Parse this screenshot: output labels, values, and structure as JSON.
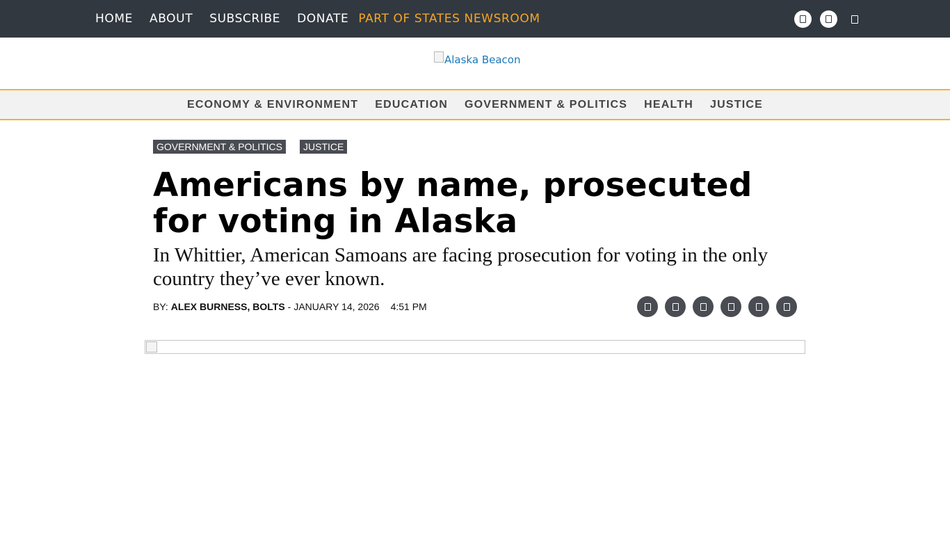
{
  "topnav": {
    "links": [
      "HOME",
      "ABOUT",
      "SUBSCRIBE",
      "DONATE"
    ],
    "states_link": "PART OF STATES NEWSROOM",
    "social_icons": [
      "facebook-icon",
      "twitter-icon"
    ],
    "search_icon": "search-icon"
  },
  "logo": {
    "alt": "Alaska Beacon"
  },
  "sections": [
    "ECONOMY & ENVIRONMENT",
    "EDUCATION",
    "GOVERNMENT & POLITICS",
    "HEALTH",
    "JUSTICE"
  ],
  "article": {
    "tags": [
      "GOVERNMENT & POLITICS",
      "JUSTICE"
    ],
    "headline": "Americans by name, prosecuted for voting in Alaska",
    "subhead": "In Whittier, American Samoans are facing prosecution for voting in the only country they’ve ever known.",
    "byline_prefix": "BY:",
    "author": "ALEX BURNESS, BOLTS",
    "separator": "-",
    "date": "JANUARY 14, 2026",
    "time": "4:51 PM",
    "share_icons": [
      "facebook-icon",
      "twitter-icon",
      "bluesky-icon",
      "email-icon",
      "print-icon",
      "link-icon"
    ]
  },
  "colors": {
    "topbar_bg": "#323840",
    "accent": "#f5a623",
    "section_border": "#f5b32a",
    "tag_bg": "#4a4c53",
    "logo_link": "#1a7ab8"
  }
}
